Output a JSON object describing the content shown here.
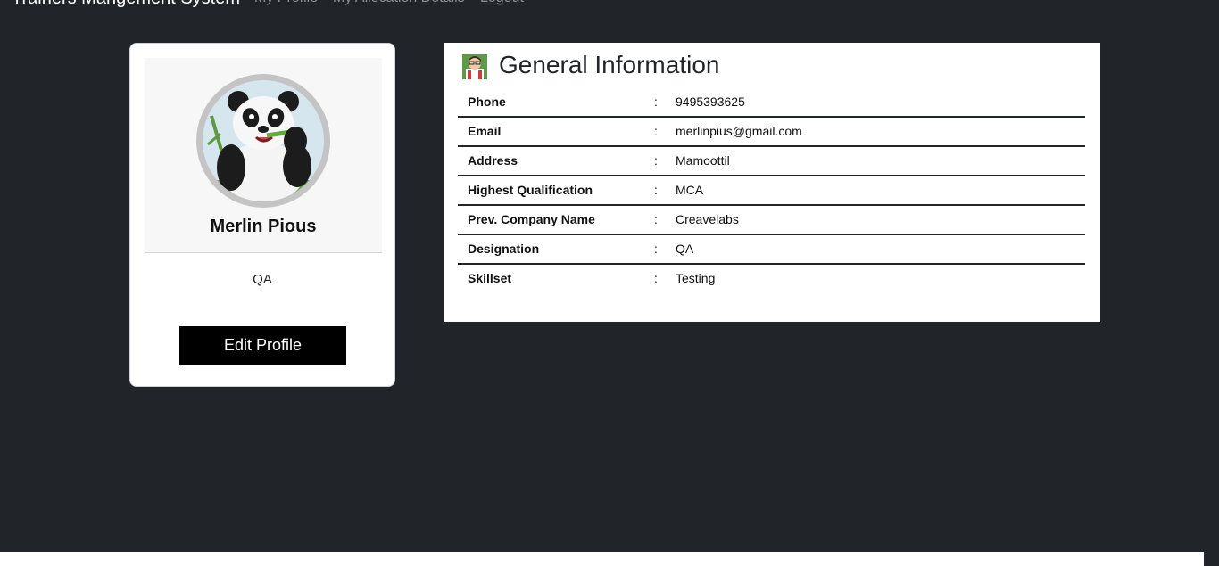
{
  "nav": {
    "brand": "Trainers Mangement System",
    "links": [
      "My Profile",
      "My Allocation Details",
      "Logout"
    ]
  },
  "profile": {
    "name": "Merlin Pious",
    "role": "QA",
    "edit_label": "Edit Profile"
  },
  "info": {
    "title": "General Information",
    "separator": ":",
    "rows": [
      {
        "label": "Phone",
        "value": "9495393625"
      },
      {
        "label": "Email",
        "value": "merlinpius@gmail.com"
      },
      {
        "label": "Address",
        "value": "Mamoottil"
      },
      {
        "label": "Highest Qualification",
        "value": "MCA"
      },
      {
        "label": "Prev. Company Name",
        "value": "Creavelabs"
      },
      {
        "label": "Designation",
        "value": "QA"
      },
      {
        "label": "Skillset",
        "value": "Testing"
      }
    ]
  },
  "colors": {
    "page_background": "#212529",
    "button_background": "#000000",
    "nav_link": "#8c9196"
  }
}
